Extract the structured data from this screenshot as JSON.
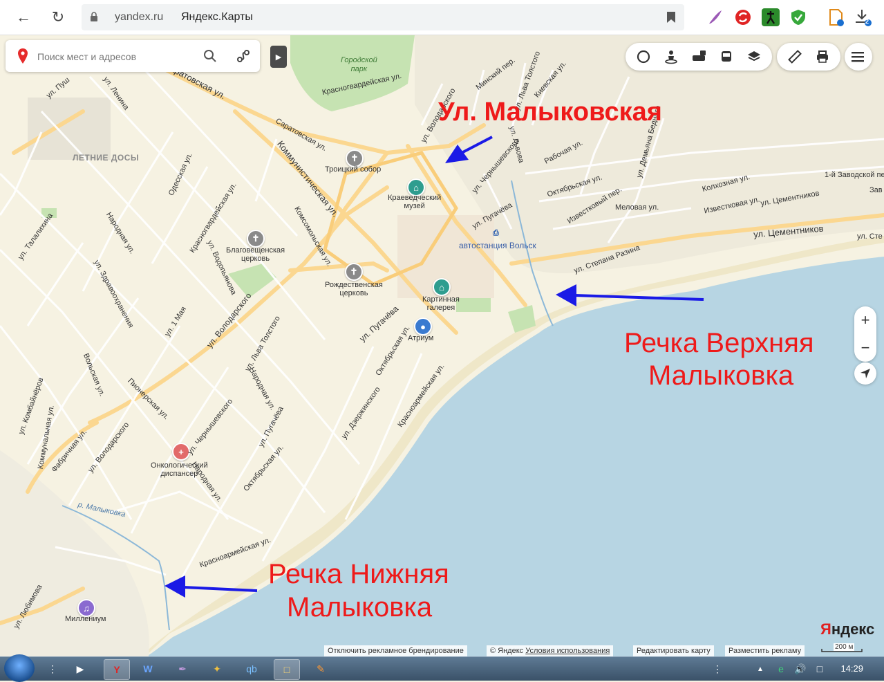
{
  "browser": {
    "domain": "yandex.ru",
    "page_title": "Яндекс.Карты",
    "downloads_badge": "2"
  },
  "search": {
    "placeholder": "Поиск мест и адресов"
  },
  "map_labels": {
    "gorodskoy_park": "Городской\nпарк",
    "letnie_dosy": "ЛЕТНИЕ ДОСЫ",
    "troitsky": "Троицкий собор",
    "kraeved": "Краеведческий\nмузей",
    "blagoveshch": "Благовещенская\nцерковь",
    "rozhdestv": "Рождественская\nцерковь",
    "kartinnaya": "Картинная\nгалерея",
    "atrium": "Атриум",
    "avtostantsiya": "автостанция Вольск",
    "onko": "Онкологический\nдиспансер",
    "millenium": "Миллениум",
    "river_malykovka": "р. Малыковка",
    "streets": [
      "ул. Пуш",
      "ул. Ленина",
      "Саратовская ул.",
      "Саратовская ул.",
      "Красногвардейская ул.",
      "ул. Володарского",
      "Минский пер.",
      "ул. Льва Толстого",
      "Киевская ул.",
      "Коммунистическая ул.",
      "ул. Чернышевского",
      "ул. Львова",
      "Рабочая ул.",
      "ул. Демьяна Бедного",
      "Одесская ул.",
      "Красногвардейская ул.",
      "ул. Водопьянова",
      "Комсомольская ул.",
      "Народная ул.",
      "ул. Талалихина",
      "ул. Здравоохранения",
      "ул. 1 Мая",
      "ул. Володарского",
      "ул. Льва Толстого",
      "Народная ул.",
      "Октябрьская ул.",
      "ул. Пугачёва",
      "ул. Пугачёва",
      "Октябрьская ул.",
      "Известковый пер.",
      "Меловая ул.",
      "Колхозная ул.",
      "Известковая ул.",
      "ул. Цементников",
      "ул. Цементников",
      "ул. Степана Разина",
      "1-й Заводской пер.",
      "ул. Сте",
      "Зав",
      "Красноармейская ул.",
      "ул. Дзержинского",
      "Вольская ул.",
      "ул. Комбайнёров",
      "Коммунальная ул.",
      "Фабричная ул.",
      "ул. Володарского",
      "Пионерская ул.",
      "ул. Чернышевского",
      "ул. Пугачёва",
      "Октябрьская ул.",
      "Народная ул.",
      "Красноармейская ул.",
      "ул. Любимова",
      "ул. Льва Толстого",
      "Народная ул.",
      "ул. Пугачёва",
      "ул. Пугачёва"
    ]
  },
  "annotations": {
    "street": "Ул. Малыковская",
    "upper_river_1": "Речка Верхняя",
    "upper_river_2": "Малыковка",
    "lower_river_1": "Речка Нижняя",
    "lower_river_2": "Малыковка"
  },
  "footer": {
    "disable_branding": "Отключить рекламное брендирование",
    "copyright": "© Яндекс",
    "terms": "Условия использования",
    "edit_map": "Редактировать карту",
    "advertise": "Разместить рекламу",
    "scale": "200 м",
    "logo_y": "Я",
    "logo_rest": "ндекс"
  },
  "taskbar": {
    "clock": "14:29"
  },
  "colors": {
    "land": "#f6f2e2",
    "water": "#b7d5e3",
    "road_major": "#fbd790",
    "park": "#c6e3b2",
    "annotation_red": "#ee1a1a",
    "arrow_blue": "#1a1ae6"
  }
}
